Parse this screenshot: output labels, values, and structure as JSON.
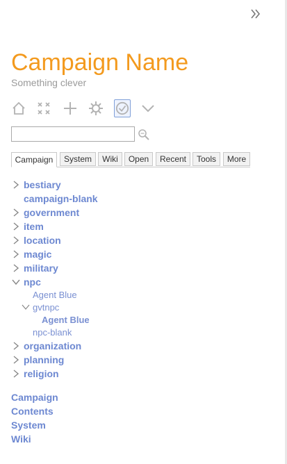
{
  "header": {
    "title": "Campaign Name",
    "subtitle": "Something clever"
  },
  "toolbar": {
    "buttons": [
      "home-icon",
      "fullscreen-icon",
      "add-icon",
      "gear-icon",
      "check-icon",
      "chevron-down-icon"
    ],
    "active_index": 4
  },
  "search": {
    "value": "",
    "placeholder": ""
  },
  "tabs": [
    {
      "label": "Campaign",
      "active": true
    },
    {
      "label": "System"
    },
    {
      "label": "Wiki"
    },
    {
      "label": "Open"
    },
    {
      "label": "Recent"
    },
    {
      "label": "Tools"
    },
    {
      "label": "More"
    }
  ],
  "tree": {
    "items": [
      {
        "label": "bestiary",
        "expandable": true,
        "expanded": false
      },
      {
        "label": "campaign-blank",
        "expandable": false
      },
      {
        "label": "government",
        "expandable": true,
        "expanded": false
      },
      {
        "label": "item",
        "expandable": true,
        "expanded": false
      },
      {
        "label": "location",
        "expandable": true,
        "expanded": false
      },
      {
        "label": "magic",
        "expandable": true,
        "expanded": false
      },
      {
        "label": "military",
        "expandable": true,
        "expanded": false
      },
      {
        "label": "npc",
        "expandable": true,
        "expanded": true,
        "children": [
          {
            "label": "Agent Blue"
          },
          {
            "label": "gvtnpc",
            "expanded": true,
            "children": [
              {
                "label": "Agent Blue"
              }
            ]
          },
          {
            "label": "npc-blank"
          }
        ]
      },
      {
        "label": "organization",
        "expandable": true,
        "expanded": false
      },
      {
        "label": "planning",
        "expandable": true,
        "expanded": false
      },
      {
        "label": "religion",
        "expandable": true,
        "expanded": false
      }
    ]
  },
  "footer": {
    "links": [
      "Campaign",
      "Contents",
      "System",
      "Wiki"
    ]
  },
  "colors": {
    "title": "#f39a1e",
    "link": "#6d88d1",
    "icon": "#9a9a9a"
  }
}
